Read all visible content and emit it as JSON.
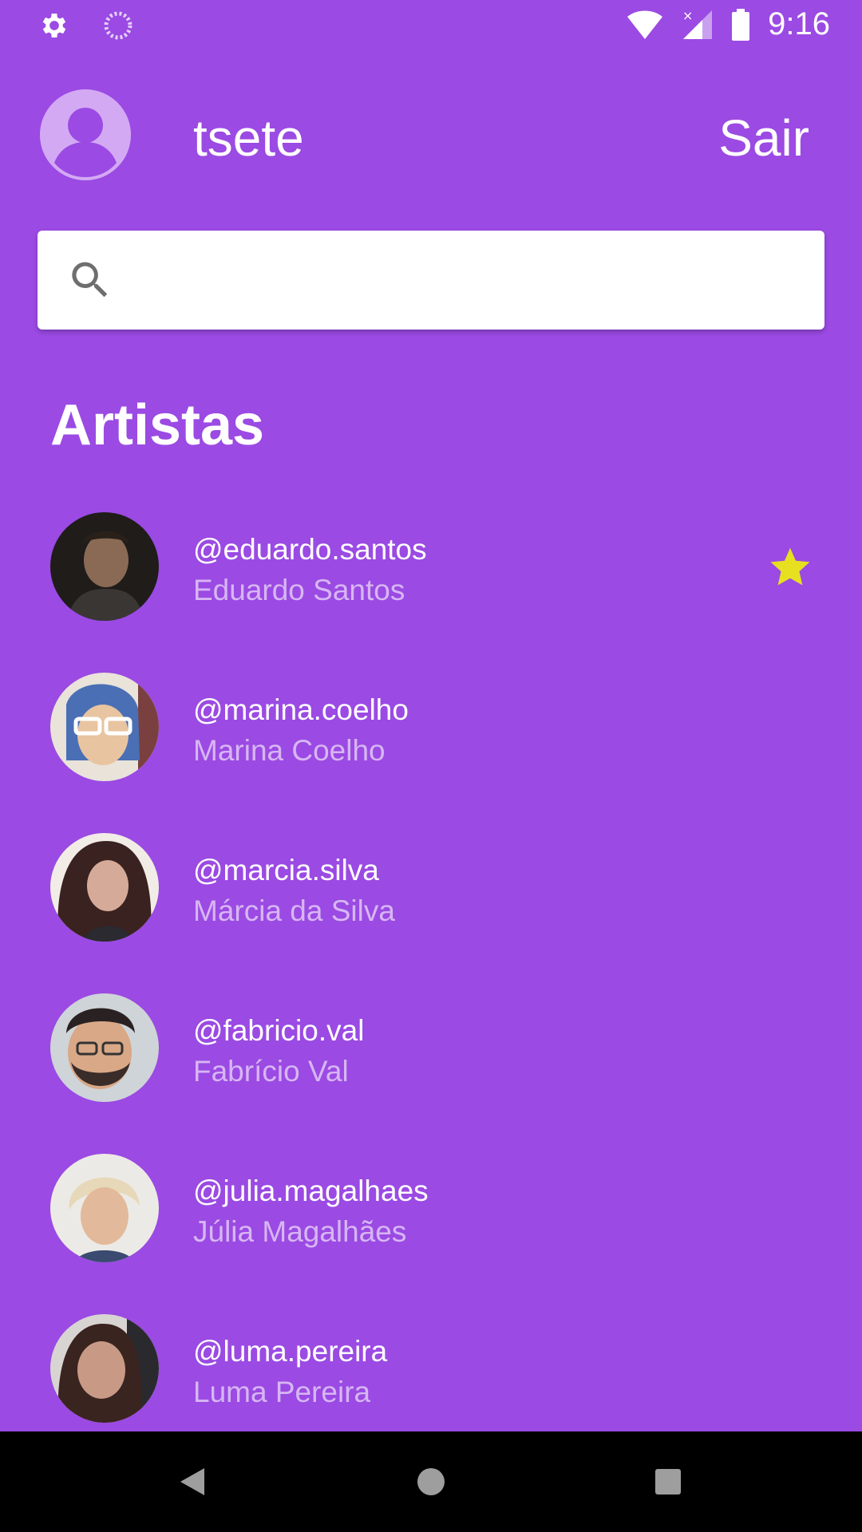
{
  "status_bar": {
    "time": "9:16",
    "icons": [
      "settings-gear-icon",
      "sync-spinner-icon",
      "wifi-icon",
      "cell-signal-icon",
      "battery-icon"
    ]
  },
  "header": {
    "username": "tsete",
    "logout_label": "Sair",
    "avatar_icon": "default-user-avatar-icon"
  },
  "search": {
    "placeholder": "",
    "value": "",
    "icon": "search-icon"
  },
  "section": {
    "title": "Artistas"
  },
  "artists": [
    {
      "handle": "@eduardo.santos",
      "name": "Eduardo Santos",
      "favorite": true,
      "colors": [
        "#2b2520",
        "#6b5a4a"
      ]
    },
    {
      "handle": "@marina.coelho",
      "name": "Marina Coelho",
      "favorite": false,
      "colors": [
        "#5a7db8",
        "#e8c9a8"
      ]
    },
    {
      "handle": "@marcia.silva",
      "name": "Márcia da Silva",
      "favorite": false,
      "colors": [
        "#3a2420",
        "#c9a090"
      ]
    },
    {
      "handle": "@fabricio.val",
      "name": "Fabrício Val",
      "favorite": false,
      "colors": [
        "#3a3030",
        "#d9a887"
      ]
    },
    {
      "handle": "@julia.magalhaes",
      "name": "Júlia Magalhães",
      "favorite": false,
      "colors": [
        "#e8dcc8",
        "#c89f80"
      ]
    },
    {
      "handle": "@luma.pereira",
      "name": "Luma Pereira",
      "favorite": false,
      "colors": [
        "#2a1c18",
        "#a87860"
      ]
    }
  ],
  "colors": {
    "background": "#9b4ae3",
    "subtext": "#d7b6f3",
    "star": "#e6e020",
    "avatar_bg": "#d3a9f4"
  },
  "navigation": {
    "buttons": [
      "back-icon",
      "home-icon",
      "recents-icon"
    ]
  }
}
